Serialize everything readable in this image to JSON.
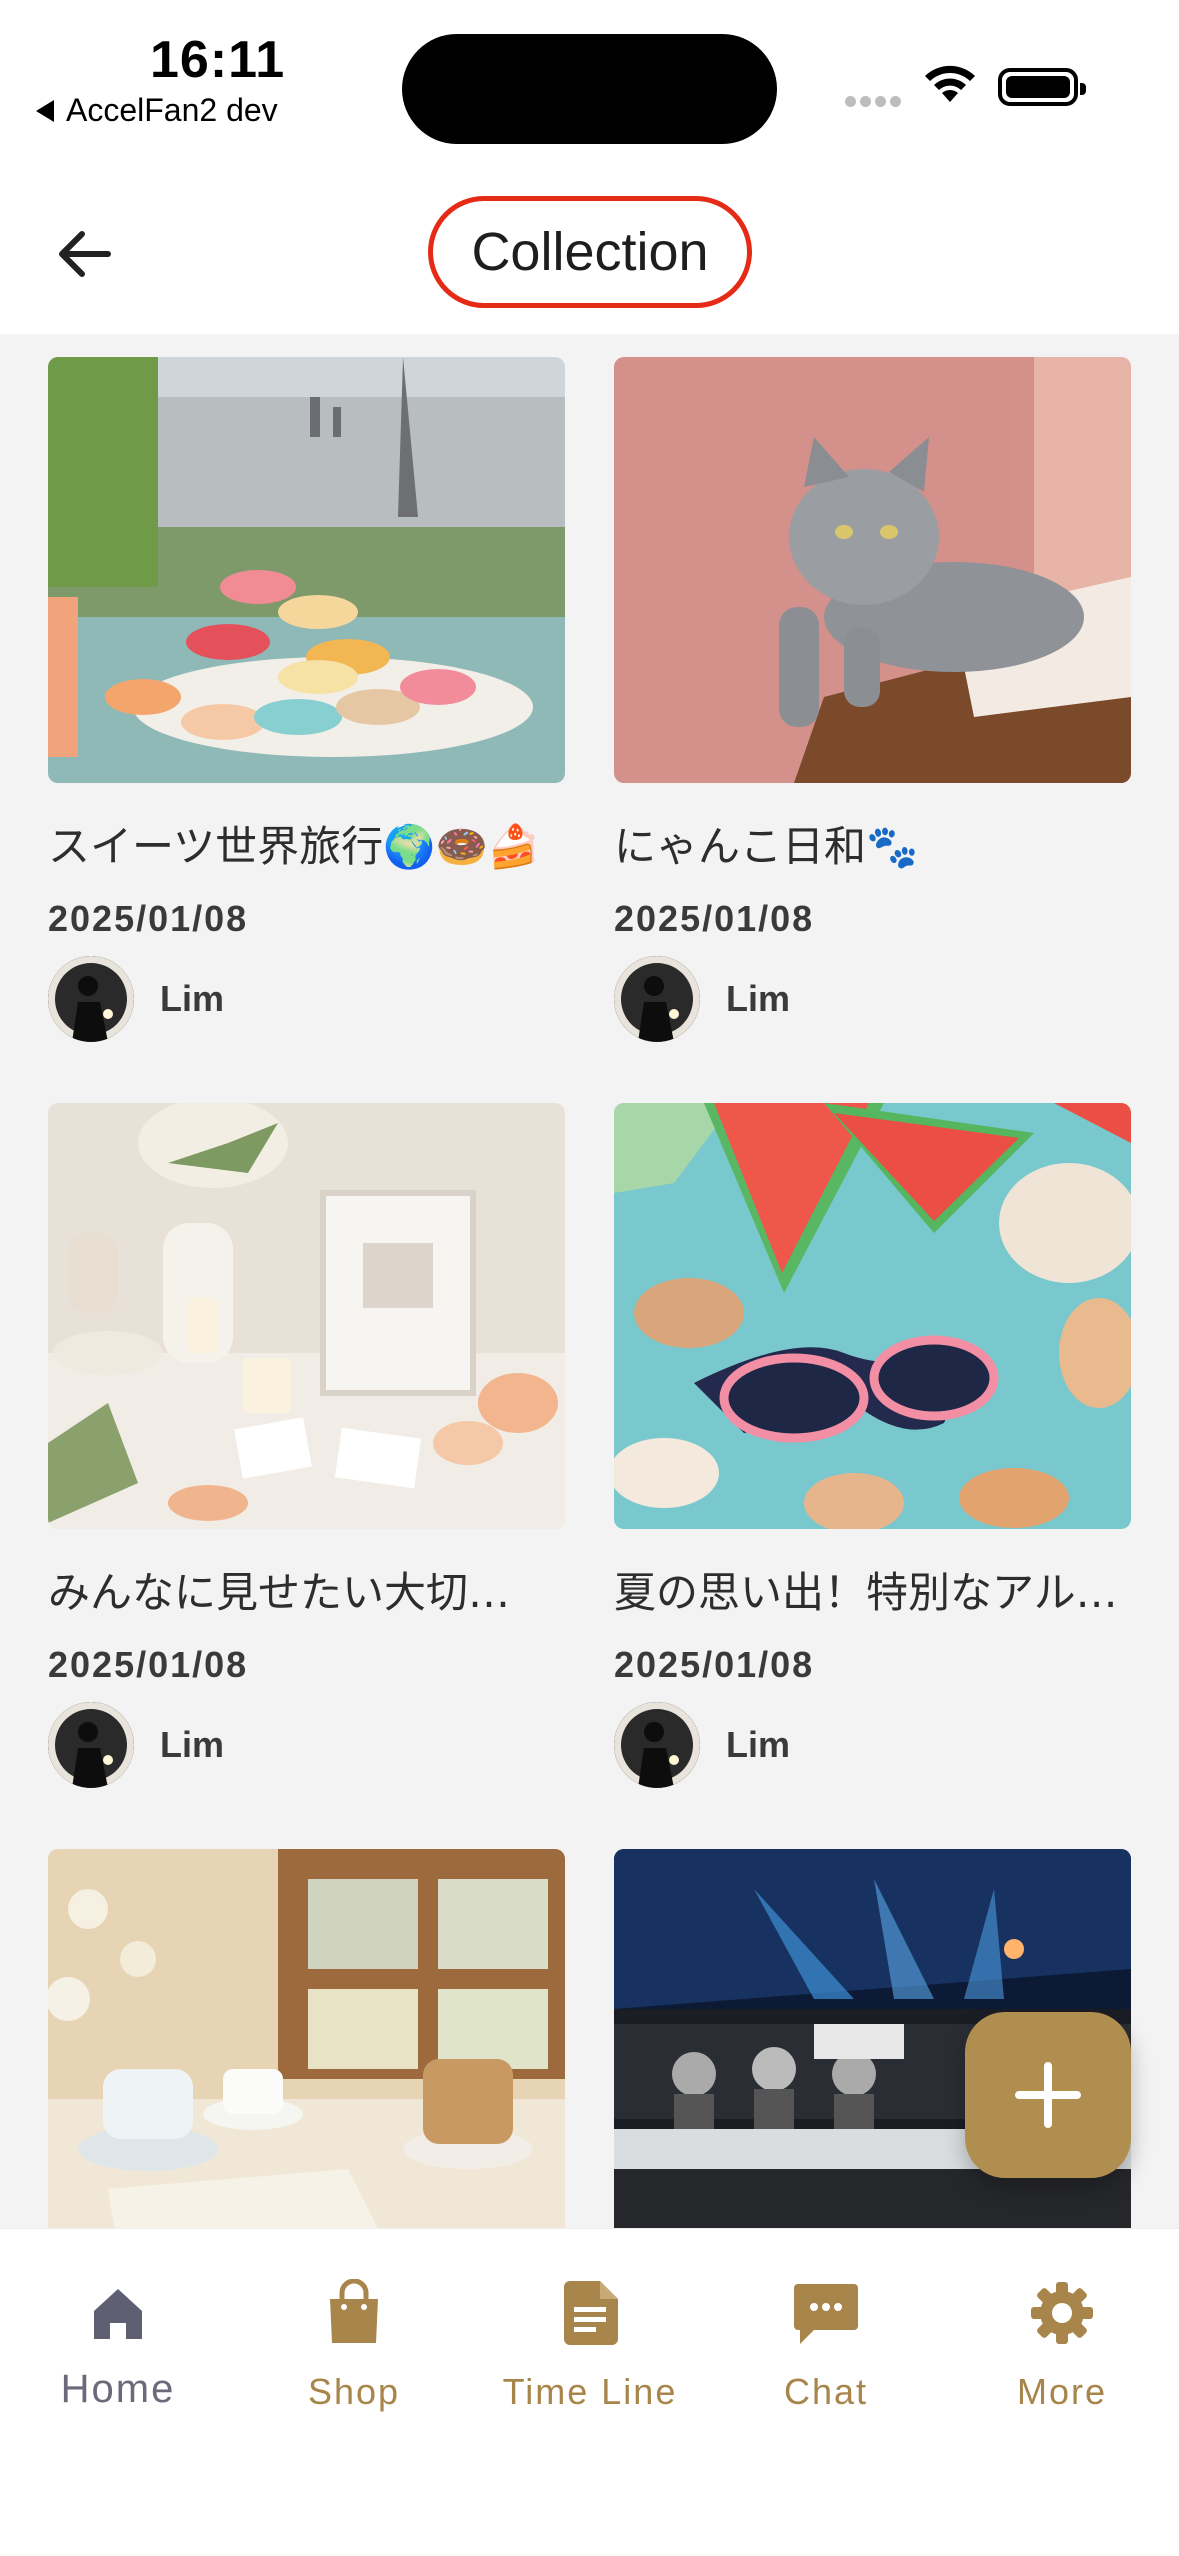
{
  "status_bar": {
    "time": "16:11",
    "back_app": "AccelFan2 dev",
    "icons": [
      "cellular-dots-icon",
      "wifi-icon",
      "battery-icon"
    ]
  },
  "header": {
    "title": "Collection",
    "back_icon": "arrow-left-icon",
    "highlight_color": "#e52a16"
  },
  "cards": [
    {
      "title": "スイーツ世界旅行🌍🍩🍰",
      "date": "2025/01/08",
      "author": "Lim",
      "image": "macarons-eiffel-tower"
    },
    {
      "title": "にゃんこ日和🐾",
      "date": "2025/01/08",
      "author": "Lim",
      "image": "grey-cat-on-ledge"
    },
    {
      "title": "みんなに見せたい大切…",
      "date": "2025/01/08",
      "author": "Lim",
      "image": "flowers-and-photo-frame"
    },
    {
      "title": "夏の思い出！特別なアル…",
      "date": "2025/01/08",
      "author": "Lim",
      "image": "watermelon-shells-sunglasses"
    },
    {
      "title": "",
      "date": "",
      "author": "",
      "image": "coffee-cups-window"
    },
    {
      "title": "",
      "date": "",
      "author": "",
      "image": "esports-stage"
    }
  ],
  "fab": {
    "icon": "plus-icon",
    "color": "#b08e4f"
  },
  "bottom_nav": {
    "items": [
      {
        "label": "Home",
        "icon": "home-icon",
        "active": true
      },
      {
        "label": "Shop",
        "icon": "shopping-bag-icon",
        "active": false
      },
      {
        "label": "Time Line",
        "icon": "document-icon",
        "active": false
      },
      {
        "label": "Chat",
        "icon": "chat-bubble-icon",
        "active": false
      },
      {
        "label": "More",
        "icon": "gear-icon",
        "active": false
      }
    ],
    "accent_color": "#a8854a",
    "active_color": "#6a6a7a"
  }
}
